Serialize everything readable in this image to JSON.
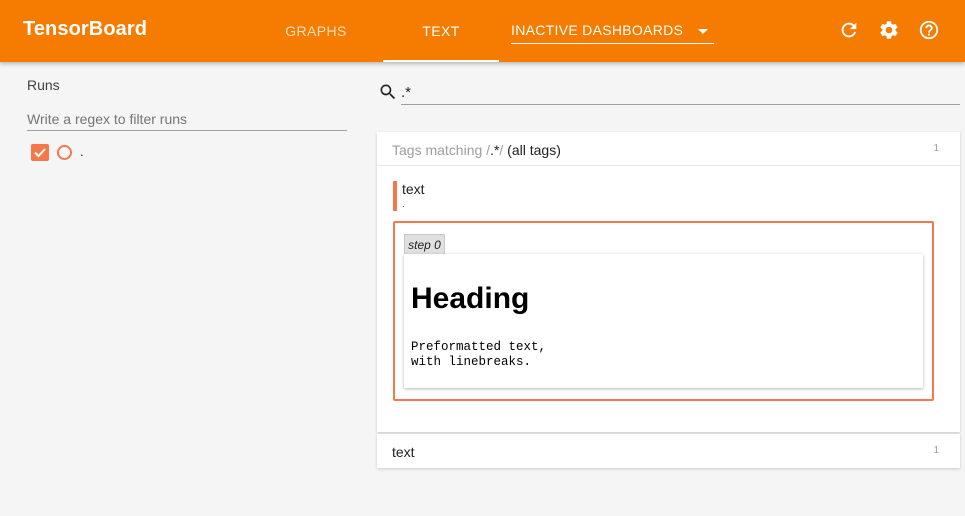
{
  "header": {
    "app_name": "TensorBoard",
    "tabs": [
      {
        "label": "GRAPHS",
        "active": false
      },
      {
        "label": "TEXT",
        "active": true
      }
    ],
    "inactive_dropdown": {
      "label": "INACTIVE DASHBOARDS"
    },
    "icons": [
      "refresh-icon",
      "settings-icon",
      "help-icon"
    ],
    "color": "#f57c00"
  },
  "sidebar": {
    "title": "Runs",
    "filter_placeholder": "Write a regex to filter runs",
    "runs": [
      {
        "label": ".",
        "checked": true,
        "color": "#f4784a"
      }
    ]
  },
  "main": {
    "search_value": ".*",
    "cards": [
      {
        "header_prefix": "Tags matching /",
        "header_pattern": ".*",
        "header_suffix": "/",
        "header_extra": " (all tags)",
        "count": "1",
        "items": [
          {
            "tag": "text",
            "run": ".",
            "steps": [
              {
                "label": "step 0",
                "heading": "Heading",
                "pre": "Preformatted text,\nwith linebreaks."
              }
            ]
          }
        ]
      },
      {
        "header_title": "text",
        "count": "1"
      }
    ]
  }
}
